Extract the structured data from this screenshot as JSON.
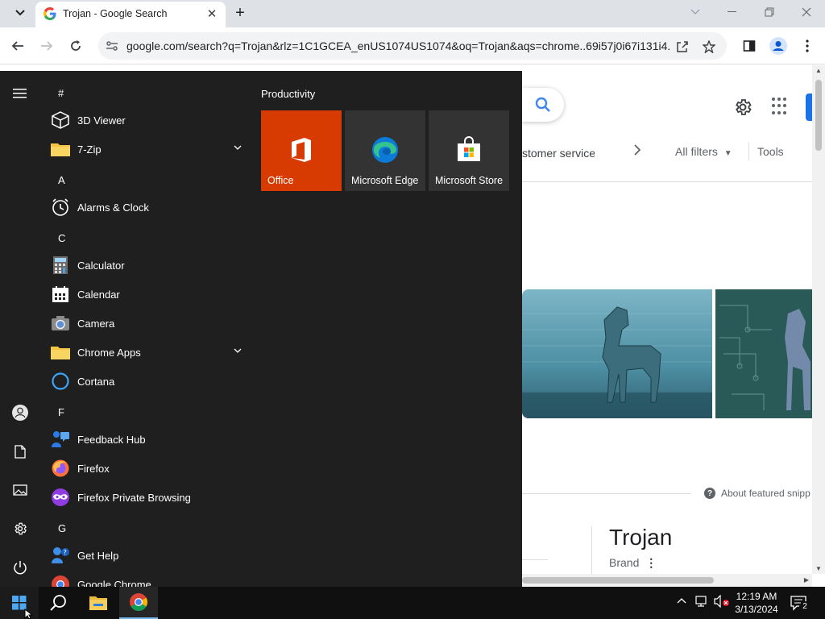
{
  "browser": {
    "tab": {
      "title": "Trojan - Google Search"
    },
    "url": "google.com/search?q=Trojan&rlz=1C1GCEA_enUS1074US1074&oq=Trojan&aqs=chrome..69i57j0i67i131i4..."
  },
  "google": {
    "chip_text": "stomer service",
    "all_filters": "All filters",
    "tools": "Tools",
    "about_featured": "About featured snipp",
    "kp_title": "Trojan",
    "kp_subtitle": "Brand"
  },
  "start_menu": {
    "groups": [
      {
        "letter": "#",
        "apps": [
          {
            "label": "3D Viewer",
            "icon": "cube-icon"
          },
          {
            "label": "7-Zip",
            "icon": "folder-icon",
            "expandable": true
          }
        ]
      },
      {
        "letter": "A",
        "apps": [
          {
            "label": "Alarms & Clock",
            "icon": "clock-icon"
          }
        ]
      },
      {
        "letter": "C",
        "apps": [
          {
            "label": "Calculator",
            "icon": "calculator-icon"
          },
          {
            "label": "Calendar",
            "icon": "calendar-icon"
          },
          {
            "label": "Camera",
            "icon": "camera-icon"
          },
          {
            "label": "Chrome Apps",
            "icon": "folder-icon",
            "expandable": true
          },
          {
            "label": "Cortana",
            "icon": "cortana-icon"
          }
        ]
      },
      {
        "letter": "F",
        "apps": [
          {
            "label": "Feedback Hub",
            "icon": "feedback-icon"
          },
          {
            "label": "Firefox",
            "icon": "firefox-icon"
          },
          {
            "label": "Firefox Private Browsing",
            "icon": "firefox-private-icon"
          }
        ]
      },
      {
        "letter": "G",
        "apps": [
          {
            "label": "Get Help",
            "icon": "help-icon"
          },
          {
            "label": "Google Chrome",
            "icon": "chrome-icon"
          }
        ]
      }
    ],
    "tiles_heading": "Productivity",
    "tiles": [
      {
        "label": "Office",
        "icon": "office-icon",
        "color": "#d83b01"
      },
      {
        "label": "Microsoft Edge",
        "icon": "edge-icon",
        "color": "#333333"
      },
      {
        "label": "Microsoft Store",
        "icon": "store-icon",
        "color": "#333333"
      }
    ]
  },
  "taskbar": {
    "time": "12:19 AM",
    "date": "3/13/2024",
    "notification_count": "2"
  }
}
